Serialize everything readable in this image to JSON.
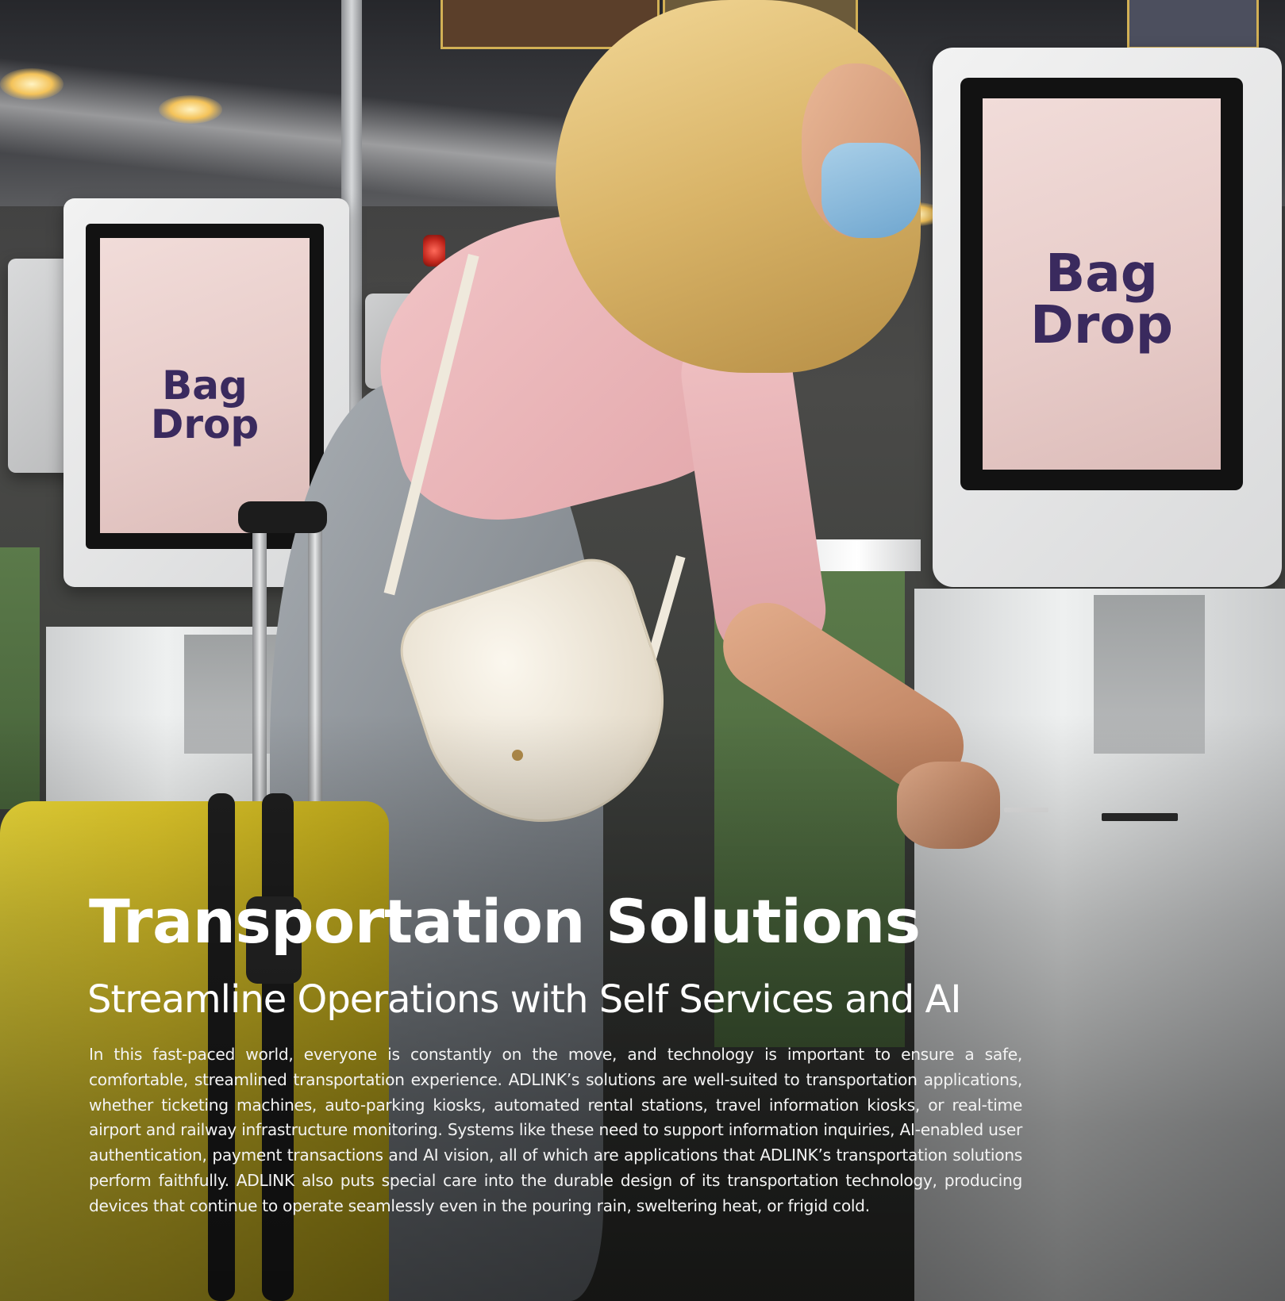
{
  "photo": {
    "kiosk_screen_left": "Bag Drop",
    "kiosk_screen_right": "Bag Drop"
  },
  "article": {
    "title": "Transportation Solutions",
    "subtitle": "Streamline Operations with Self Services and AI",
    "body": "In this fast-paced world, everyone is constantly on the move, and technology is important to ensure a safe, comfortable, streamlined transportation experience. ADLINK’s solutions are well-suited to transportation applications, whether ticketing machines, auto-parking kiosks, automated rental stations, travel information kiosks, or real-time airport and railway infrastructure monitoring. Systems like these need to support information inquiries, AI-enabled user authentication, payment transactions and AI vision, all of which are applications that ADLINK’s transportation solutions perform faithfully. ADLINK also puts special care into the durable design of its transportation technology, producing devices that continue to operate seamlessly even in the pouring rain, sweltering heat, or frigid cold."
  }
}
